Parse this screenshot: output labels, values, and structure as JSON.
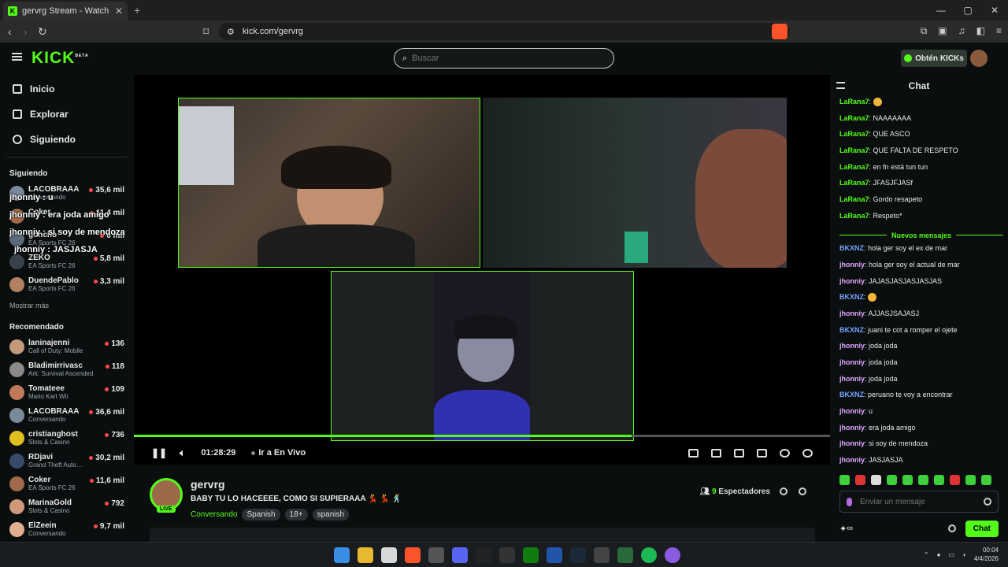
{
  "browser": {
    "tab_title": "gervrg Stream - Watch Live o",
    "tab_close": "✕",
    "new_tab": "+",
    "url": "kick.com/gervrg",
    "win_min": "—",
    "win_max": "▢",
    "win_close": "✕"
  },
  "header": {
    "logo": "KICK",
    "logo_badge": "BETA",
    "search_placeholder": "Buscar",
    "kicks_label": "Obtén KICKs"
  },
  "sidebar": {
    "nav": [
      {
        "label": "Inicio"
      },
      {
        "label": "Explorar"
      },
      {
        "label": "Siguiendo"
      }
    ],
    "following_header": "Siguiendo",
    "following": [
      {
        "name": "LACOBRAAA",
        "category": "Conversando",
        "viewers": "35,6 mil",
        "color": "#7a8a9a"
      },
      {
        "name": "Coker",
        "category": "",
        "viewers": "11,4 mil",
        "color": "#a06a4a"
      },
      {
        "name": "goncho",
        "category": "EA Sports FC 26",
        "viewers": "6 mil",
        "color": "#5a6a7a"
      },
      {
        "name": "ZEKO",
        "category": "EA Sports FC 26",
        "viewers": "5,8 mil",
        "color": "#39414a"
      },
      {
        "name": "DuendePablo",
        "category": "EA Sports FC 26",
        "viewers": "3,3 mil",
        "color": "#b08060"
      }
    ],
    "overlay_chat": [
      "jhonniy : u",
      "jhonniy : era joda amigo",
      "jhonniy : si soy de mendoza",
      "jhonniy : JASJASJA"
    ],
    "show_more": "Mostrar más",
    "recommended_header": "Recomendado",
    "recommended": [
      {
        "name": "laninajenni",
        "category": "Call of Duty: Mobile",
        "viewers": "136",
        "color": "#c49a7a"
      },
      {
        "name": "Bladimirrivasc",
        "category": "Ark: Survival Ascended",
        "viewers": "118",
        "color": "#8a8a8a"
      },
      {
        "name": "Tomateee",
        "category": "Mario Kart Wii",
        "viewers": "109",
        "color": "#c07a5a"
      },
      {
        "name": "LACOBRAAA",
        "category": "Conversando",
        "viewers": "36,6 mil",
        "color": "#7a8a9a"
      },
      {
        "name": "cristianghost",
        "category": "Slots & Casino",
        "viewers": "736",
        "color": "#e0c020"
      },
      {
        "name": "RDjavi",
        "category": "Grand Theft Auto…",
        "viewers": "30,2 mil",
        "color": "#3a4a6a"
      },
      {
        "name": "Coker",
        "category": "EA Sports FC 26",
        "viewers": "11,6 mil",
        "color": "#a06a4a"
      },
      {
        "name": "MarinaGold",
        "category": "Slots & Casino",
        "viewers": "792",
        "color": "#d09a7a"
      },
      {
        "name": "ElZeein",
        "category": "Conversando",
        "viewers": "9,7 mil",
        "color": "#e0b090"
      }
    ]
  },
  "player": {
    "time": "01:28:29",
    "live_label": "Ir a En Vivo",
    "progress": 0.715
  },
  "stream": {
    "username": "gervrg",
    "live_badge": "LIVE",
    "title": "BABY TU LO HACEEEE, COMO SI SUPIERAAA 💃 💃 🕺",
    "category": "Conversando",
    "tags": [
      "Spanish",
      "18+",
      "spanish"
    ],
    "viewers_count": "9",
    "viewers_label": "Espectadores"
  },
  "chat": {
    "title": "Chat",
    "new_messages": "Nuevos mensajes",
    "messages_before": [
      {
        "user": "LaRana7",
        "text": "",
        "emote": true,
        "color": "#53fc18"
      },
      {
        "user": "LaRana7",
        "text": "NAAAAAAA",
        "color": "#53fc18"
      },
      {
        "user": "LaRana7",
        "text": "QUE ASCO",
        "color": "#53fc18"
      },
      {
        "user": "LaRana7",
        "text": "QUE FALTA DE RESPETO",
        "color": "#53fc18"
      },
      {
        "user": "LaRana7",
        "text": "en fn está tun tun",
        "color": "#53fc18"
      },
      {
        "user": "LaRana7",
        "text": "JFASJFJASf",
        "color": "#53fc18"
      },
      {
        "user": "LaRana7",
        "text": "Gordo resapeto",
        "color": "#53fc18"
      },
      {
        "user": "LaRana7",
        "text": "Respeto*",
        "color": "#53fc18"
      }
    ],
    "messages_after": [
      {
        "user": "BKXNZ",
        "text": "hola ger soy el ex de mar",
        "color": "#74a6ff"
      },
      {
        "user": "jhonniy",
        "text": "hola ger soy el actual de mar",
        "color": "#e0a6ff"
      },
      {
        "user": "jhonniy",
        "text": "JAJASJASJASJASJAS",
        "color": "#e0a6ff"
      },
      {
        "user": "BKXNZ",
        "text": "",
        "emote": true,
        "color": "#74a6ff"
      },
      {
        "user": "jhonniy",
        "text": "AJJASJSAJASJ",
        "color": "#e0a6ff"
      },
      {
        "user": "BKXNZ",
        "text": "juani te cot a romper el ojete",
        "color": "#74a6ff"
      },
      {
        "user": "jhonniy",
        "text": "joda joda",
        "color": "#e0a6ff"
      },
      {
        "user": "jhonniy",
        "text": "joda joda",
        "color": "#e0a6ff"
      },
      {
        "user": "jhonniy",
        "text": "joda joda",
        "color": "#e0a6ff"
      },
      {
        "user": "BKXNZ",
        "text": "peruano te voy a encontrar",
        "color": "#74a6ff"
      },
      {
        "user": "jhonniy",
        "text": "u",
        "color": "#e0a6ff"
      },
      {
        "user": "jhonniy",
        "text": "era joda amigo",
        "color": "#e0a6ff"
      },
      {
        "user": "jhonniy",
        "text": "si soy de mendoza",
        "color": "#e0a6ff"
      },
      {
        "user": "jhonniy",
        "text": "JASJASJA",
        "color": "#e0a6ff"
      }
    ],
    "input_placeholder": "Enviar un mensaje",
    "infinity": "∞",
    "send_label": "Chat"
  },
  "taskbar": {
    "time": "00:04",
    "date": "4/4/2026"
  }
}
